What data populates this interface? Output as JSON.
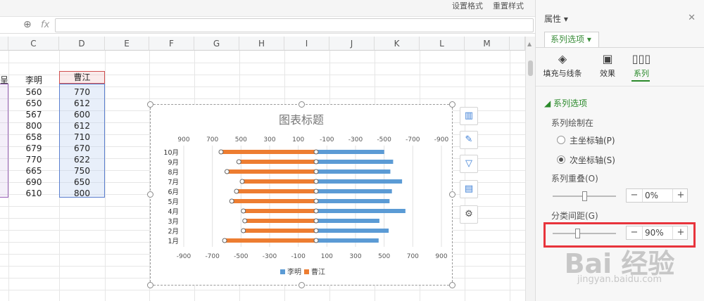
{
  "toolbar": {
    "right_items": [
      "设置格式",
      "重置样式"
    ]
  },
  "formula_bar": {
    "fx_label": "fx",
    "value": ""
  },
  "columns": [
    "C",
    "D",
    "E",
    "F",
    "G",
    "H",
    "I",
    "J",
    "K",
    "L",
    "M"
  ],
  "cells": {
    "c_header": "李明",
    "d_header": "曹江",
    "partial_b": "呈",
    "c_values": [
      "560",
      "650",
      "567",
      "800",
      "658",
      "679",
      "770",
      "665",
      "690",
      "610"
    ],
    "d_values": [
      "770",
      "612",
      "600",
      "612",
      "710",
      "670",
      "622",
      "750",
      "650",
      "800"
    ]
  },
  "chart_data": {
    "type": "bar",
    "title": "图表标题",
    "categories": [
      "1月",
      "2月",
      "3月",
      "4月",
      "5月",
      "6月",
      "7月",
      "8月",
      "9月",
      "10月"
    ],
    "series": [
      {
        "name": "李明",
        "values": [
          560,
          650,
          567,
          800,
          658,
          679,
          770,
          665,
          690,
          610
        ],
        "color": "#5b9bd5",
        "axis": "primary",
        "direction": "right"
      },
      {
        "name": "曹江",
        "values": [
          770,
          612,
          600,
          612,
          710,
          670,
          622,
          750,
          650,
          800
        ],
        "color": "#ed7d31",
        "axis": "secondary",
        "direction": "left"
      }
    ],
    "top_axis_ticks": [
      "900",
      "700",
      "500",
      "300",
      "100",
      "-100",
      "-300",
      "-500",
      "-700",
      "-900"
    ],
    "bottom_axis_ticks": [
      "-900",
      "-700",
      "-500",
      "-300",
      "-100",
      "100",
      "300",
      "500",
      "700",
      "900"
    ],
    "xlim": [
      -900,
      900
    ],
    "legend": "bottom",
    "grid": true
  },
  "chart_tools": [
    "chart-elements",
    "chart-style",
    "chart-filter",
    "chart-data",
    "chart-settings"
  ],
  "panel": {
    "title": "属性",
    "tab": "系列选项",
    "subtabs": [
      {
        "label": "填充与线条",
        "icon": "fill-bucket-icon"
      },
      {
        "label": "效果",
        "icon": "effects-icon"
      },
      {
        "label": "系列",
        "icon": "bar-series-icon"
      }
    ],
    "section": "系列选项",
    "plot_on_label": "系列绘制在",
    "radio_primary": "主坐标轴(P)",
    "radio_secondary": "次坐标轴(S)",
    "overlap_label": "系列重叠(O)",
    "overlap_value": "0%",
    "gap_label": "分类间距(G)",
    "gap_value": "90%",
    "minus": "−",
    "plus": "+"
  },
  "watermark": {
    "text": "Bai 经验",
    "subtext": "jingyan.baidu.com"
  }
}
